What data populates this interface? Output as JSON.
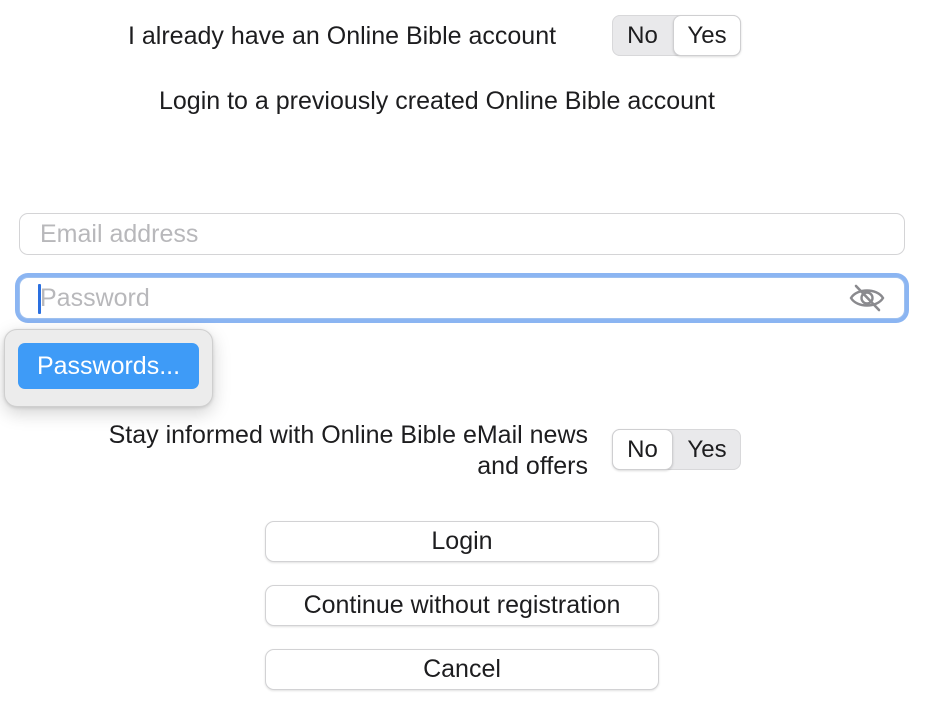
{
  "account": {
    "question": "I already have an Online Bible account",
    "toggle": {
      "no_label": "No",
      "yes_label": "Yes",
      "selected": "Yes"
    },
    "subtitle": "Login to a previously created Online Bible account"
  },
  "form": {
    "email": {
      "value": "",
      "placeholder": "Email address"
    },
    "password": {
      "value": "",
      "placeholder": "Password",
      "visibility_icon": "eye-slash-icon"
    }
  },
  "autofill": {
    "item_label": "Passwords..."
  },
  "newsletter": {
    "question_line1": "Stay informed with Online Bible eMail news",
    "question_line2": "and offers",
    "toggle": {
      "no_label": "No",
      "yes_label": "Yes",
      "selected": "No"
    }
  },
  "buttons": {
    "login": "Login",
    "continue": "Continue without registration",
    "cancel": "Cancel"
  }
}
